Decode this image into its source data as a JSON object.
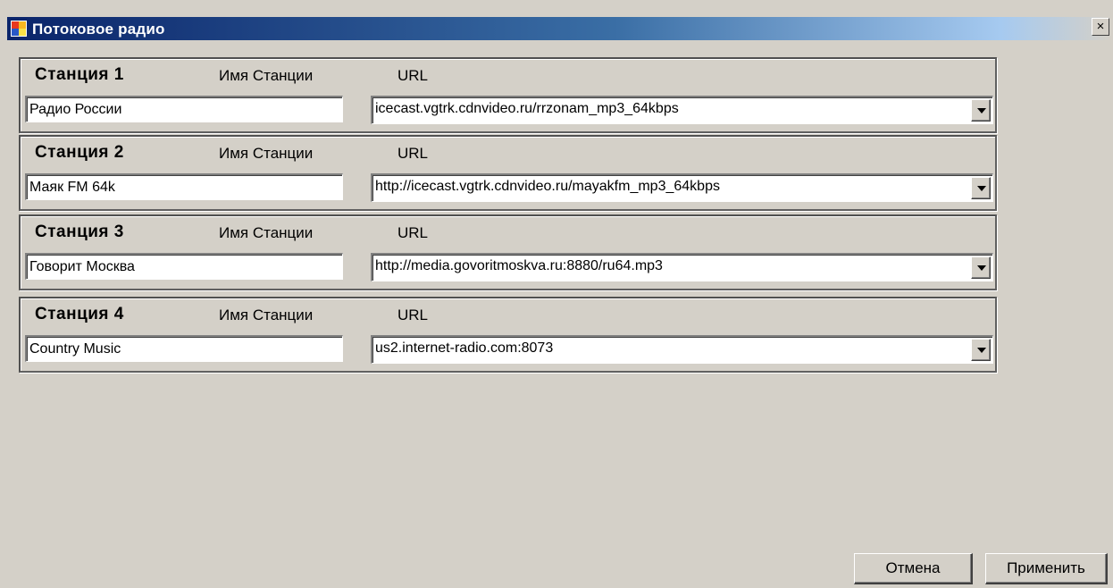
{
  "window": {
    "title": "Потоковое радио",
    "close_glyph": "×",
    "title_icon": "app-window-icon"
  },
  "labels": {
    "name_column": "Имя Станции",
    "url_column": "URL"
  },
  "stations": [
    {
      "title": "Станция 1",
      "name": "Радио России",
      "url": "icecast.vgtrk.cdnvideo.ru/rrzonam_mp3_64kbps"
    },
    {
      "title": "Станция 2",
      "name": "Маяк FM 64k",
      "url": "http://icecast.vgtrk.cdnvideo.ru/mayakfm_mp3_64kbps"
    },
    {
      "title": "Станция 3",
      "name": "Говорит Москва",
      "url": "http://media.govoritmoskva.ru:8880/ru64.mp3"
    },
    {
      "title": "Станция 4",
      "name": "Country Music",
      "url": "us2.internet-radio.com:8073"
    }
  ],
  "buttons": {
    "cancel": "Отмена",
    "apply": "Применить"
  },
  "colors": {
    "window_bg": "#d4d0c8",
    "titlebar_start": "#0a246a",
    "titlebar_end": "#a6caf0"
  }
}
